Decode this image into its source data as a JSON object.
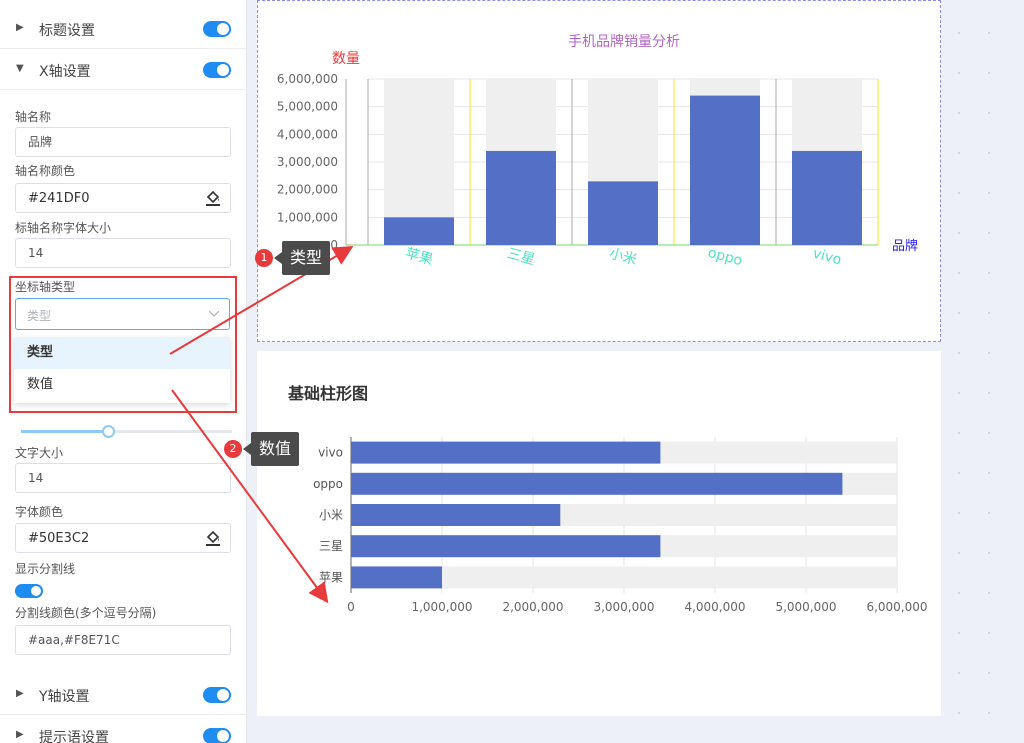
{
  "panel": {
    "title_section": "标题设置",
    "xaxis_section": "X轴设置",
    "axis_name_label": "轴名称",
    "axis_name_value": "品牌",
    "axis_name_color_label": "轴名称颜色",
    "axis_name_color_value": "#241DF0",
    "axis_name_size_label": "标轴名称字体大小",
    "axis_name_size_value": "14",
    "axis_type_label": "坐标轴类型",
    "axis_type_placeholder": "类型",
    "axis_type_options": [
      "类型",
      "数值"
    ],
    "text_size_label": "文字大小",
    "text_size_value": "14",
    "font_color_label": "字体颜色",
    "font_color_value": "#50E3C2",
    "show_split_label": "显示分割线",
    "split_color_label": "分割线颜色(多个逗号分隔)",
    "split_color_value": "#aaa,#F8E71C",
    "yaxis_section": "Y轴设置",
    "tooltip_section": "提示语设置",
    "slider_level": 0.42
  },
  "callouts": {
    "one_num": "1",
    "one_text": "类型",
    "two_num": "2",
    "two_text": "数值"
  },
  "colors": {
    "bar": "#5470c6",
    "bar_bg": "#efefef",
    "title": "#b366c6",
    "yname": "#e8393c",
    "xname": "#241DF0",
    "xlabel": "#50E3C2",
    "accent": "#1e8cf0"
  },
  "chart_data": [
    {
      "type": "bar",
      "title": "手机品牌销量分析",
      "xlabel": "品牌",
      "ylabel": "数量",
      "categories": [
        "苹果",
        "三星",
        "小米",
        "oppo",
        "vivo"
      ],
      "values": [
        1000000,
        3400000,
        2300000,
        5400000,
        3400000
      ],
      "ylim": [
        0,
        6000000
      ],
      "yticks": [
        "0",
        "1,000,000",
        "2,000,000",
        "3,000,000",
        "4,000,000",
        "5,000,000",
        "6,000,000"
      ],
      "grid": true
    },
    {
      "type": "bar",
      "orientation": "horizontal",
      "title": "基础柱形图",
      "categories": [
        "苹果",
        "三星",
        "小米",
        "oppo",
        "vivo"
      ],
      "values": [
        1000000,
        3400000,
        2300000,
        5400000,
        3400000
      ],
      "xlim": [
        0,
        6000000
      ],
      "xticks": [
        "0",
        "1,000,000",
        "2,000,000",
        "3,000,000",
        "4,000,000",
        "5,000,000",
        "6,000,000"
      ],
      "grid": true
    }
  ]
}
